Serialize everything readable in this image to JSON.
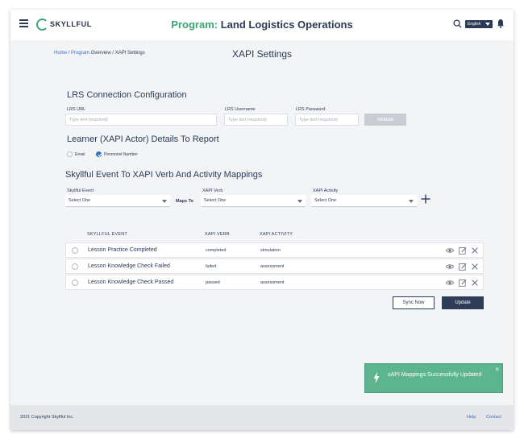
{
  "header": {
    "logo_text": "SKYLLFUL",
    "program_prefix": "Program:",
    "program_name": "Land Logistics Operations",
    "language": "English"
  },
  "breadcrumb": {
    "home": "Home",
    "sep1": " / ",
    "program": "Program",
    "overview": " Overview / XAPI Settings"
  },
  "page_title": "XAPI Settings",
  "lrs": {
    "title": "LRS Connection Configuration",
    "url_label": "LRS URL",
    "url_placeholder": "Type text (required)",
    "username_label": "LRS Username",
    "username_placeholder": "Type text (required)",
    "password_label": "LRS Password",
    "password_placeholder": "Type text (required)",
    "validate_label": "Validate"
  },
  "learner": {
    "title": "Learner (XAPI Actor) Details To Report",
    "options": [
      "Email",
      "Personnel Number"
    ],
    "selected": "Personnel Number"
  },
  "mappings": {
    "title": "Skyllful Event To XAPI Verb And Activity Mappings",
    "event_label": "Skyllful Event",
    "maps_to": "Maps To",
    "verb_label": "XAPI Verb",
    "activity_label": "XAPI Activity",
    "select_placeholder": "Select One"
  },
  "table": {
    "headers": [
      "SKYLLFUL EVENT",
      "XAPI VERB",
      "XAPI ACTIVITY"
    ],
    "rows": [
      {
        "event": "Lesson Practice Completed",
        "verb": "completed",
        "activity": "simulation"
      },
      {
        "event": "Lesson Knowledge Check Failed",
        "verb": "failed",
        "activity": "assessment"
      },
      {
        "event": "Lesson Knowledge Check Passed",
        "verb": "passed",
        "activity": "assessment"
      }
    ]
  },
  "actions": {
    "sync_label": "Sync Now",
    "update_label": "Update"
  },
  "toast": {
    "message": "xAPI Mappings Successfully Updated",
    "close": "×"
  },
  "footer": {
    "copyright": "2021 Copyright Skyllful Inc.",
    "help": "Help",
    "contact": "Contact"
  },
  "colors": {
    "accent": "#3aa676",
    "navy": "#2e3c57",
    "link": "#3b6bbf",
    "toast": "#5db590"
  }
}
